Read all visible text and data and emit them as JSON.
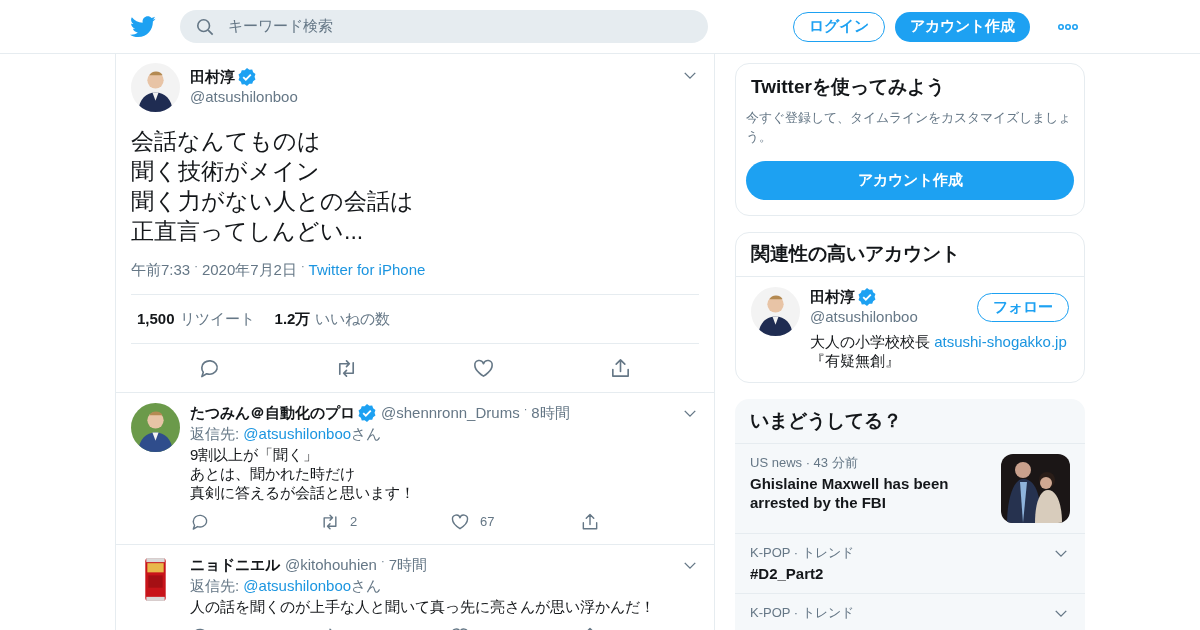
{
  "header": {
    "search_placeholder": "キーワード検索",
    "login": "ログイン",
    "signup": "アカウント作成"
  },
  "tweet": {
    "name": "田村淳",
    "verified": true,
    "handle": "@atsushilonboo",
    "lines": [
      "会話なんてものは",
      "聞く技術がメイン",
      "聞く力がない人との会話は",
      "正直言ってしんどい..."
    ],
    "separator": "·",
    "time": "午前7:33",
    "date": "2020年7月2日",
    "source": "Twitter for iPhone",
    "retweets": {
      "count": "1,500",
      "label": "リツイート"
    },
    "likes": {
      "count": "1.2万",
      "label": "いいねの数"
    }
  },
  "replies": [
    {
      "name": "たつみん＠自動化のプロ",
      "verified": true,
      "handle": "@shennronn_Drums",
      "time": "8時間",
      "reply_prefix": "返信先: ",
      "reply_to": "@atsushilonboo",
      "reply_suffix": "さん",
      "lines": [
        "9割以上が「聞く」",
        "あとは、聞かれた時だけ",
        "真剣に答えるが会話と思います！"
      ],
      "retweets": "2",
      "likes": "67"
    },
    {
      "name": "ニョドニエル",
      "verified": false,
      "handle": "@kitohouhien",
      "time": "7時間",
      "reply_prefix": "返信先: ",
      "reply_to": "@atsushilonboo",
      "reply_suffix": "さん",
      "lines": [
        "人の話を聞くのが上手な人と聞いて真っ先に亮さんが思い浮かんだ！"
      ]
    }
  ],
  "sidebar": {
    "signup_card": {
      "title": "Twitterを使ってみよう",
      "text": "今すぐ登録して、タイムラインをカスタマイズしましょう。",
      "button": "アカウント作成"
    },
    "related": {
      "title": "関連性の高いアカウント",
      "accounts": [
        {
          "name": "田村淳",
          "verified": true,
          "handle": "@atsushilonboo",
          "follow": "フォロー",
          "bio": "大人の小学校校長 ",
          "link": "atsushi-shogakko.jp",
          "bio_end": "『有疑無創』"
        }
      ]
    },
    "trends": {
      "title": "いまどうしてる？",
      "items": [
        {
          "kind": "news",
          "meta": "US news · 43 分前",
          "title": "Ghislaine Maxwell has been arrested by the FBI"
        },
        {
          "kind": "trend",
          "meta": "K-POP · トレンド",
          "title": "#D2_Part2"
        },
        {
          "kind": "trend",
          "meta": "K-POP · トレンド"
        }
      ]
    }
  }
}
